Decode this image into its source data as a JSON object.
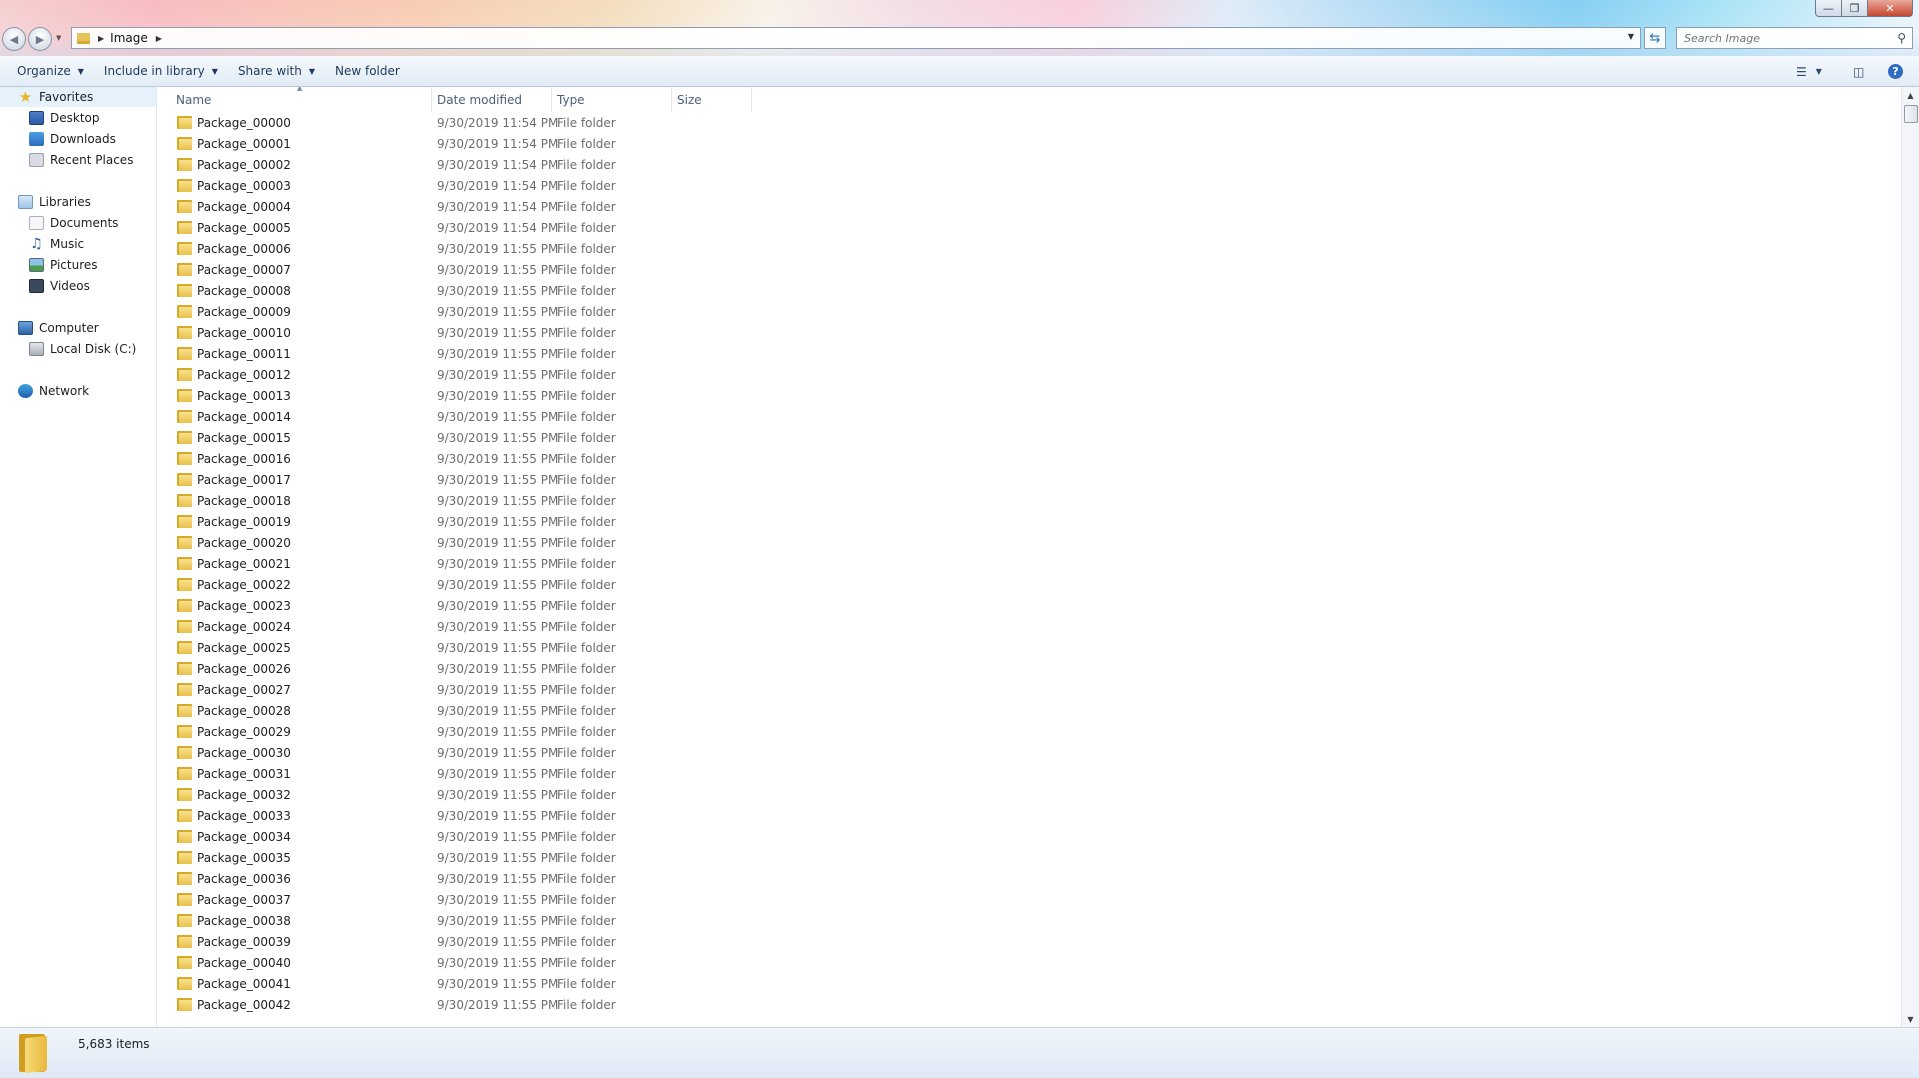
{
  "window": {
    "controls": [
      "minimize",
      "maximize",
      "close"
    ]
  },
  "address": {
    "segments": [
      "Image"
    ]
  },
  "search": {
    "placeholder": "Search Image"
  },
  "toolbar": {
    "organize": "Organize",
    "include_in_library": "Include in library",
    "share_with": "Share with",
    "new_folder": "New folder"
  },
  "sidebar": {
    "favorites": "Favorites",
    "desktop": "Desktop",
    "downloads": "Downloads",
    "recent_places": "Recent Places",
    "libraries": "Libraries",
    "documents": "Documents",
    "music": "Music",
    "pictures": "Pictures",
    "videos": "Videos",
    "computer": "Computer",
    "local_disk": "Local Disk (C:)",
    "network": "Network"
  },
  "columns": {
    "name": "Name",
    "date": "Date modified",
    "type": "Type",
    "size": "Size"
  },
  "files": [
    {
      "name": "Package_00000",
      "date": "9/30/2019 11:54 PM",
      "type": "File folder"
    },
    {
      "name": "Package_00001",
      "date": "9/30/2019 11:54 PM",
      "type": "File folder"
    },
    {
      "name": "Package_00002",
      "date": "9/30/2019 11:54 PM",
      "type": "File folder"
    },
    {
      "name": "Package_00003",
      "date": "9/30/2019 11:54 PM",
      "type": "File folder"
    },
    {
      "name": "Package_00004",
      "date": "9/30/2019 11:54 PM",
      "type": "File folder"
    },
    {
      "name": "Package_00005",
      "date": "9/30/2019 11:54 PM",
      "type": "File folder"
    },
    {
      "name": "Package_00006",
      "date": "9/30/2019 11:55 PM",
      "type": "File folder"
    },
    {
      "name": "Package_00007",
      "date": "9/30/2019 11:55 PM",
      "type": "File folder"
    },
    {
      "name": "Package_00008",
      "date": "9/30/2019 11:55 PM",
      "type": "File folder"
    },
    {
      "name": "Package_00009",
      "date": "9/30/2019 11:55 PM",
      "type": "File folder"
    },
    {
      "name": "Package_00010",
      "date": "9/30/2019 11:55 PM",
      "type": "File folder"
    },
    {
      "name": "Package_00011",
      "date": "9/30/2019 11:55 PM",
      "type": "File folder"
    },
    {
      "name": "Package_00012",
      "date": "9/30/2019 11:55 PM",
      "type": "File folder"
    },
    {
      "name": "Package_00013",
      "date": "9/30/2019 11:55 PM",
      "type": "File folder"
    },
    {
      "name": "Package_00014",
      "date": "9/30/2019 11:55 PM",
      "type": "File folder"
    },
    {
      "name": "Package_00015",
      "date": "9/30/2019 11:55 PM",
      "type": "File folder"
    },
    {
      "name": "Package_00016",
      "date": "9/30/2019 11:55 PM",
      "type": "File folder"
    },
    {
      "name": "Package_00017",
      "date": "9/30/2019 11:55 PM",
      "type": "File folder"
    },
    {
      "name": "Package_00018",
      "date": "9/30/2019 11:55 PM",
      "type": "File folder"
    },
    {
      "name": "Package_00019",
      "date": "9/30/2019 11:55 PM",
      "type": "File folder"
    },
    {
      "name": "Package_00020",
      "date": "9/30/2019 11:55 PM",
      "type": "File folder"
    },
    {
      "name": "Package_00021",
      "date": "9/30/2019 11:55 PM",
      "type": "File folder"
    },
    {
      "name": "Package_00022",
      "date": "9/30/2019 11:55 PM",
      "type": "File folder"
    },
    {
      "name": "Package_00023",
      "date": "9/30/2019 11:55 PM",
      "type": "File folder"
    },
    {
      "name": "Package_00024",
      "date": "9/30/2019 11:55 PM",
      "type": "File folder"
    },
    {
      "name": "Package_00025",
      "date": "9/30/2019 11:55 PM",
      "type": "File folder"
    },
    {
      "name": "Package_00026",
      "date": "9/30/2019 11:55 PM",
      "type": "File folder"
    },
    {
      "name": "Package_00027",
      "date": "9/30/2019 11:55 PM",
      "type": "File folder"
    },
    {
      "name": "Package_00028",
      "date": "9/30/2019 11:55 PM",
      "type": "File folder"
    },
    {
      "name": "Package_00029",
      "date": "9/30/2019 11:55 PM",
      "type": "File folder"
    },
    {
      "name": "Package_00030",
      "date": "9/30/2019 11:55 PM",
      "type": "File folder"
    },
    {
      "name": "Package_00031",
      "date": "9/30/2019 11:55 PM",
      "type": "File folder"
    },
    {
      "name": "Package_00032",
      "date": "9/30/2019 11:55 PM",
      "type": "File folder"
    },
    {
      "name": "Package_00033",
      "date": "9/30/2019 11:55 PM",
      "type": "File folder"
    },
    {
      "name": "Package_00034",
      "date": "9/30/2019 11:55 PM",
      "type": "File folder"
    },
    {
      "name": "Package_00035",
      "date": "9/30/2019 11:55 PM",
      "type": "File folder"
    },
    {
      "name": "Package_00036",
      "date": "9/30/2019 11:55 PM",
      "type": "File folder"
    },
    {
      "name": "Package_00037",
      "date": "9/30/2019 11:55 PM",
      "type": "File folder"
    },
    {
      "name": "Package_00038",
      "date": "9/30/2019 11:55 PM",
      "type": "File folder"
    },
    {
      "name": "Package_00039",
      "date": "9/30/2019 11:55 PM",
      "type": "File folder"
    },
    {
      "name": "Package_00040",
      "date": "9/30/2019 11:55 PM",
      "type": "File folder"
    },
    {
      "name": "Package_00041",
      "date": "9/30/2019 11:55 PM",
      "type": "File folder"
    },
    {
      "name": "Package_00042",
      "date": "9/30/2019 11:55 PM",
      "type": "File folder"
    }
  ],
  "status": {
    "item_count": "5,683 items"
  }
}
